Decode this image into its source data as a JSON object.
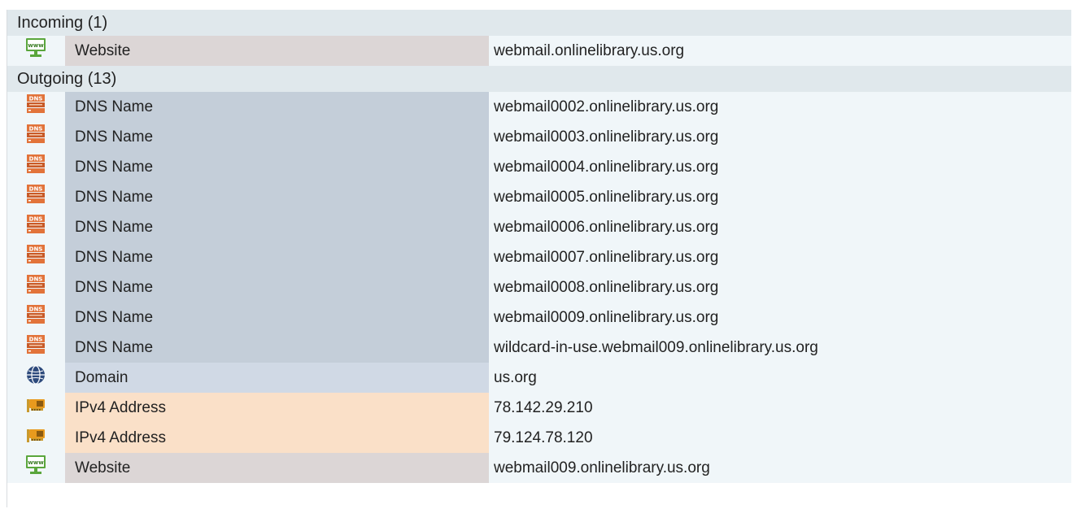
{
  "sections": [
    {
      "header": "Incoming (1)",
      "rows": [
        {
          "icon": "www-monitor-icon",
          "type": "Website",
          "value": "webmail.onlinelibrary.us.org"
        }
      ]
    },
    {
      "header": "Outgoing (13)",
      "rows": [
        {
          "icon": "dns-server-icon",
          "type": "DNS Name",
          "value": "webmail0002.onlinelibrary.us.org"
        },
        {
          "icon": "dns-server-icon",
          "type": "DNS Name",
          "value": "webmail0003.onlinelibrary.us.org"
        },
        {
          "icon": "dns-server-icon",
          "type": "DNS Name",
          "value": "webmail0004.onlinelibrary.us.org"
        },
        {
          "icon": "dns-server-icon",
          "type": "DNS Name",
          "value": "webmail0005.onlinelibrary.us.org"
        },
        {
          "icon": "dns-server-icon",
          "type": "DNS Name",
          "value": "webmail0006.onlinelibrary.us.org"
        },
        {
          "icon": "dns-server-icon",
          "type": "DNS Name",
          "value": "webmail0007.onlinelibrary.us.org"
        },
        {
          "icon": "dns-server-icon",
          "type": "DNS Name",
          "value": "webmail0008.onlinelibrary.us.org"
        },
        {
          "icon": "dns-server-icon",
          "type": "DNS Name",
          "value": "webmail0009.onlinelibrary.us.org"
        },
        {
          "icon": "dns-server-icon",
          "type": "DNS Name",
          "value": "wildcard-in-use.webmail009.onlinelibrary.us.org"
        },
        {
          "icon": "globe-icon",
          "type": "Domain",
          "value": "us.org"
        },
        {
          "icon": "network-card-icon",
          "type": "IPv4 Address",
          "value": "78.142.29.210"
        },
        {
          "icon": "network-card-icon",
          "type": "IPv4 Address",
          "value": "79.124.78.120"
        },
        {
          "icon": "www-monitor-icon",
          "type": "Website",
          "value": "webmail009.onlinelibrary.us.org"
        }
      ]
    }
  ],
  "colors": {
    "header_bg": "#e0e8ec",
    "row_bg": "#f0f6f9",
    "website": "#dcd6d6",
    "dns": "#c4ced9",
    "domain": "#d0d9e5",
    "ipv4": "#fae0c8"
  }
}
